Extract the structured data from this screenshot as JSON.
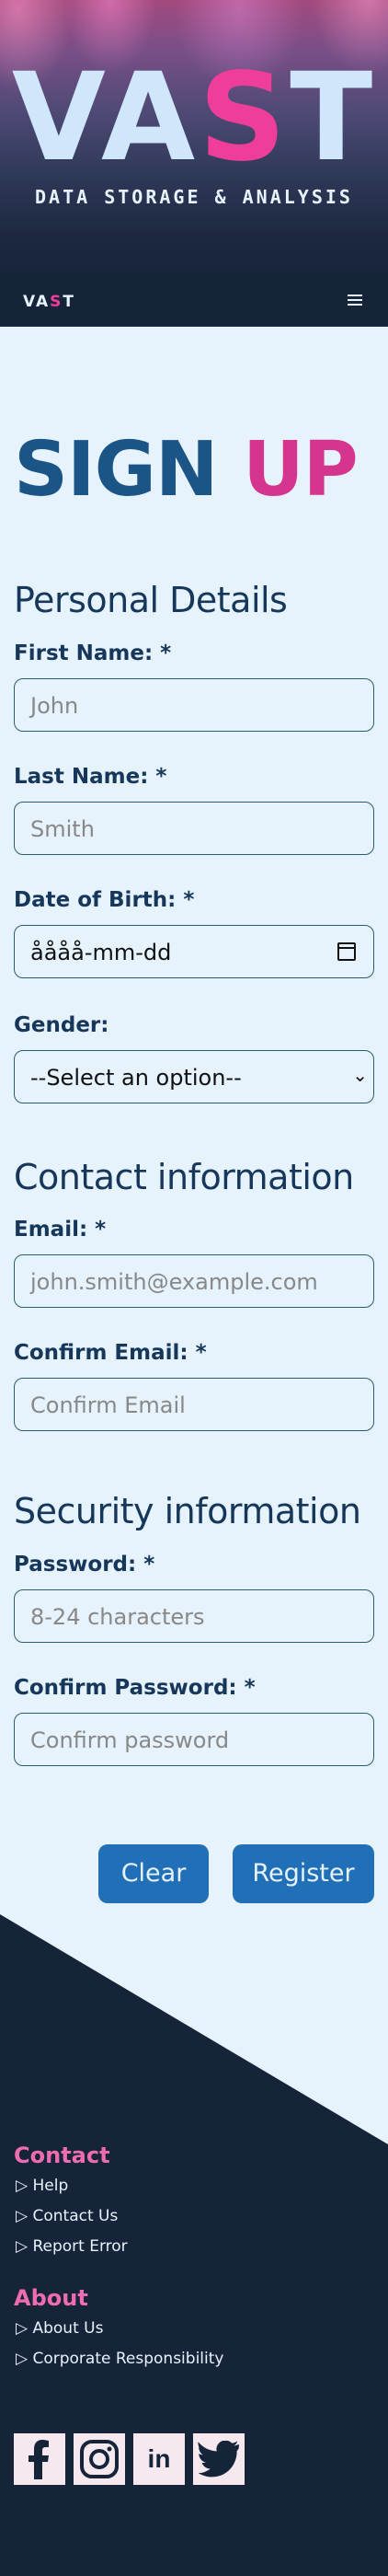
{
  "hero": {
    "logo_part1": "VA",
    "logo_part2": "S",
    "logo_part3": "T",
    "subtitle": "DATA STORAGE & ANALYSIS"
  },
  "nav": {
    "logo_part1": "VA",
    "logo_part2": "S",
    "logo_part3": "T",
    "menu_icon": "hamburger-icon"
  },
  "page": {
    "title_part1": "SIGN",
    "title_part2": "UP"
  },
  "personal": {
    "heading": "Personal Details",
    "first_name_label": "First Name: *",
    "first_name_placeholder": "John",
    "last_name_label": "Last Name: *",
    "last_name_placeholder": "Smith",
    "dob_label": "Date of Birth: *",
    "dob_value": "åååå-mm-dd",
    "gender_label": "Gender:",
    "gender_selected": "--Select an option--"
  },
  "contact": {
    "heading": "Contact information",
    "email_label": "Email: *",
    "email_placeholder": "john.smith@example.com",
    "confirm_email_label": "Confirm Email: *",
    "confirm_email_placeholder": "Confirm Email"
  },
  "security": {
    "heading": "Security information",
    "password_label": "Password: *",
    "password_placeholder": "8-24 characters",
    "confirm_password_label": "Confirm Password: *",
    "confirm_password_placeholder": "Confirm password"
  },
  "buttons": {
    "clear": "Clear",
    "register": "Register"
  },
  "footer": {
    "contact_heading": "Contact",
    "contact_links": [
      "▷ Help",
      "▷ Contact Us",
      "▷ Report Error"
    ],
    "about_heading": "About",
    "about_links": [
      "▷ About Us",
      "▷ Corporate Responsibility"
    ],
    "social_icons": [
      "facebook-icon",
      "instagram-icon",
      "linkedin-icon",
      "twitter-icon"
    ],
    "linkedin_text": "in"
  },
  "colors": {
    "page_bg": "#e6f3fd",
    "navy": "#16243a",
    "title_blue": "#1b5486",
    "pink": "#ef3d9a",
    "button_blue": "#2170b7",
    "footer_pink": "#f06cb2"
  }
}
